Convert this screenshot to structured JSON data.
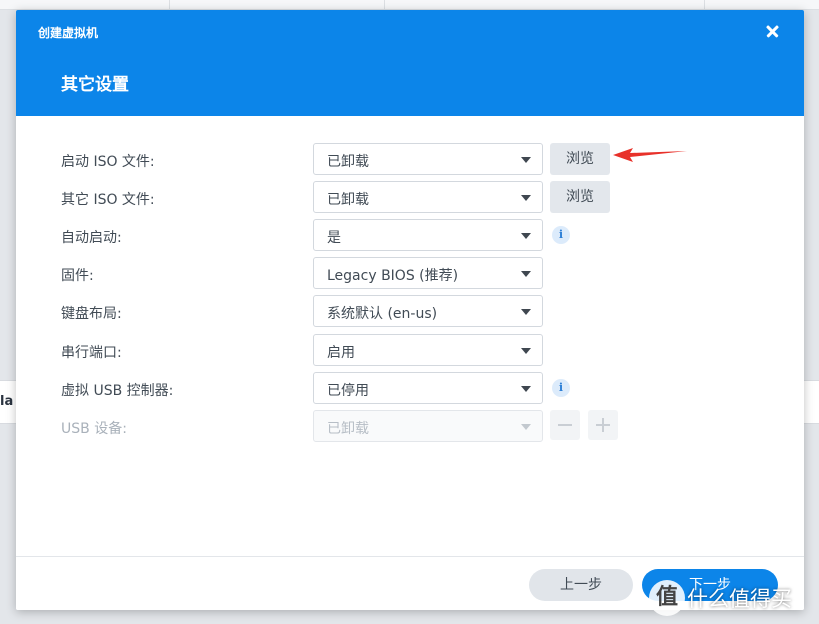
{
  "dialog": {
    "window_title": "创建虚拟机",
    "page_title": "其它设置"
  },
  "background": {
    "partial_label": "la"
  },
  "form": {
    "rows": [
      {
        "label": "启动 ISO 文件:",
        "value": "已卸载",
        "browse_label": "浏览"
      },
      {
        "label": "其它 ISO 文件:",
        "value": "已卸载",
        "browse_label": "浏览"
      },
      {
        "label": "自动启动:",
        "value": "是",
        "info_icon": "i"
      },
      {
        "label": "固件:",
        "value": "Legacy BIOS (推荐)"
      },
      {
        "label": "键盘布局:",
        "value": "系统默认 (en-us)"
      },
      {
        "label": "串行端口:",
        "value": "启用"
      },
      {
        "label": "虚拟 USB 控制器:",
        "value": "已停用",
        "info_icon": "i"
      },
      {
        "label": "USB 设备:",
        "value": "已卸载",
        "disabled": true
      }
    ]
  },
  "footer": {
    "prev_label": "上一步",
    "next_label": "下一步"
  },
  "watermark": {
    "logo_glyph": "值",
    "text": "什么值得买"
  },
  "colors": {
    "header_blue": "#0c85e9",
    "annotation_arrow": "#e8312a"
  }
}
